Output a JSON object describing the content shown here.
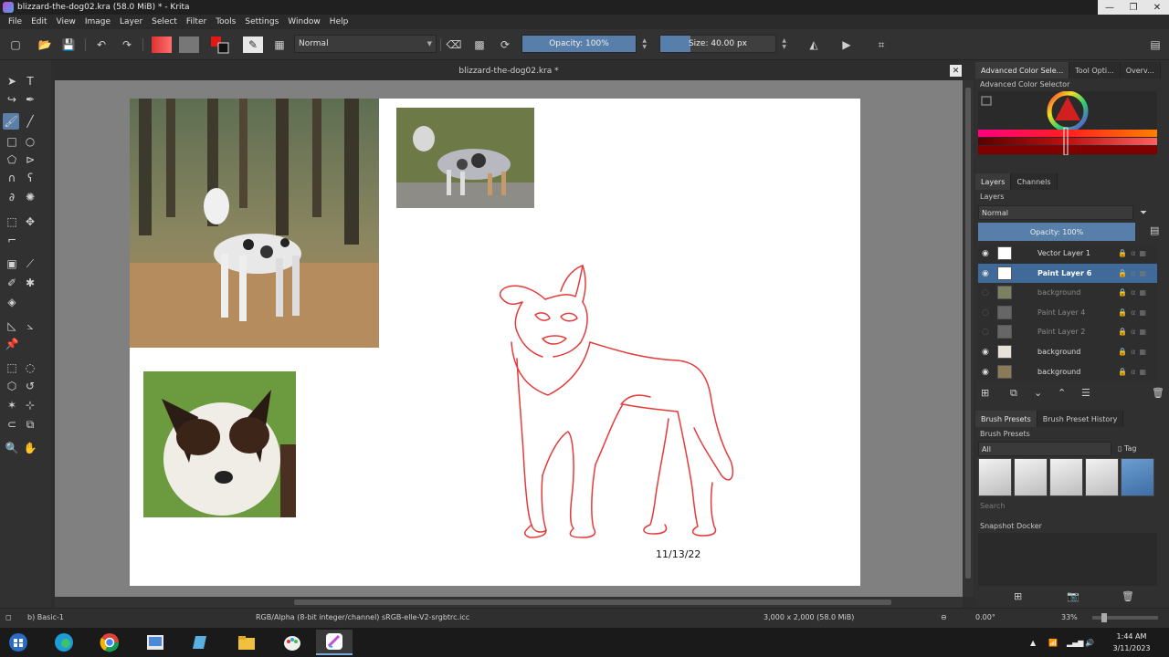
{
  "window": {
    "title": "blizzard-the-dog02.kra (58.0 MiB)  * - Krita",
    "minimize": "—",
    "maximize": "❐",
    "close": "✕"
  },
  "menu": [
    "File",
    "Edit",
    "View",
    "Image",
    "Layer",
    "Select",
    "Filter",
    "Tools",
    "Settings",
    "Window",
    "Help"
  ],
  "toolbar": {
    "blend_mode": "Normal",
    "opacity_label": "Opacity: 100%",
    "opacity_value": 100,
    "size_label": "Size: 40.00 px"
  },
  "document": {
    "tab_title": "blizzard-the-dog02.kra *",
    "date_text": "11/13/22"
  },
  "dockers": {
    "top_tabs": [
      "Advanced Color Sele...",
      "Tool Opti...",
      "Overv..."
    ],
    "color_selector_label": "Advanced Color Selector",
    "layer_tabs": [
      "Layers",
      "Channels"
    ],
    "layers_label": "Layers",
    "layers_blend": "Normal",
    "layers_opacity": "Opacity:  100%",
    "layers": [
      {
        "name": "Vector Layer 1",
        "visible": true,
        "selected": false
      },
      {
        "name": "Paint Layer 6",
        "visible": true,
        "selected": true
      },
      {
        "name": "background",
        "visible": false,
        "selected": false
      },
      {
        "name": "Paint Layer 4",
        "visible": false,
        "selected": false
      },
      {
        "name": "Paint Layer 2",
        "visible": false,
        "selected": false
      },
      {
        "name": "background",
        "visible": true,
        "selected": false
      },
      {
        "name": "background",
        "visible": true,
        "selected": false
      }
    ],
    "brush_tabs": [
      "Brush Presets",
      "Brush Preset History"
    ],
    "brush_presets_label": "Brush Presets",
    "brush_filter": "All",
    "brush_tag": "Tag",
    "brush_search_placeholder": "Search",
    "snapshot_label": "Snapshot Docker"
  },
  "status": {
    "brush": "b) Basic-1",
    "colorspace": "RGB/Alpha (8-bit integer/channel)  sRGB-elle-V2-srgbtrc.icc",
    "dimensions": "3,000 x 2,000 (58.0 MiB)",
    "rotation": "0.00°",
    "zoom": "33%"
  },
  "taskbar": {
    "time": "1:44 AM",
    "date": "3/11/2023"
  },
  "colors": {
    "accent": "#587fa9",
    "sketch_red": "#e53a3a"
  }
}
